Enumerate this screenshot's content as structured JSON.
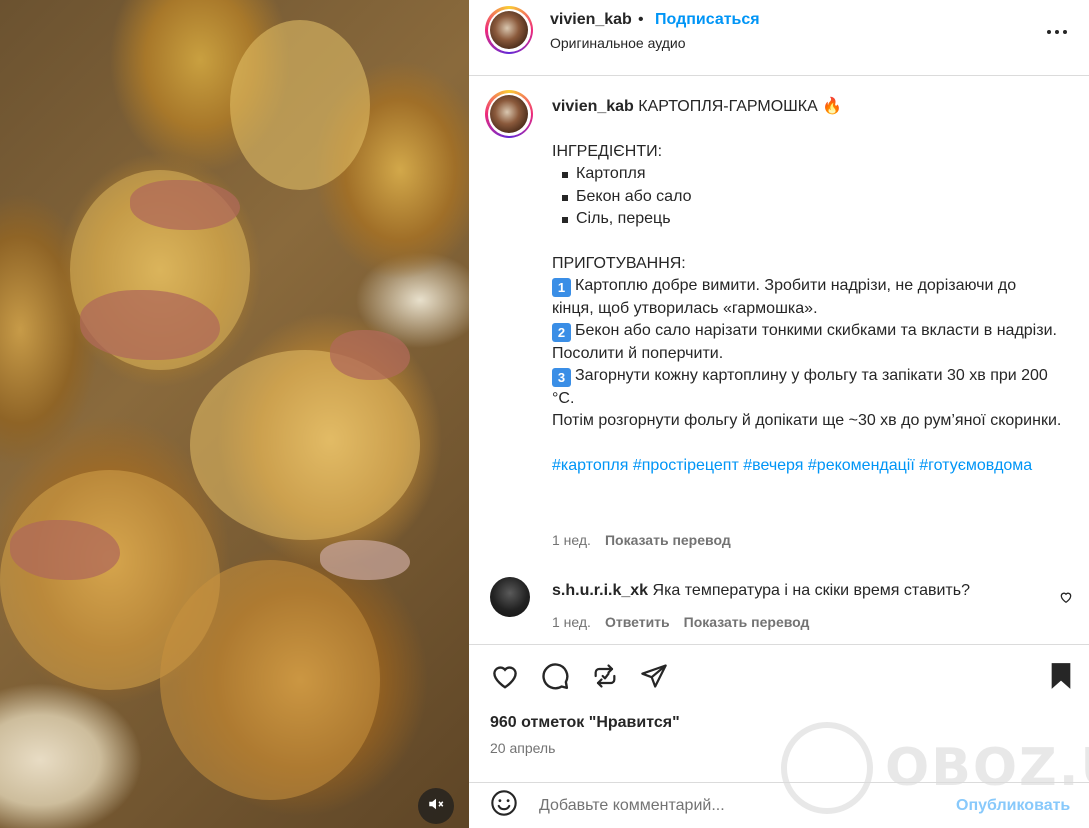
{
  "post": {
    "username": "vivien_kab",
    "dot": "•",
    "follow_label": "Подписаться",
    "audio": "Оригинальное аудио"
  },
  "caption": {
    "username": "vivien_kab",
    "title": "КАРТОПЛЯ-ГАРМОШКА 🔥",
    "ingredients_heading": "ІНГРЕДІЄНТИ:",
    "ingredients": [
      "Картопля",
      "Бекон або сало",
      "Сіль, перець"
    ],
    "steps_heading": "ПРИГОТУВАННЯ:",
    "steps": [
      {
        "num": "1",
        "text": "Картоплю добре вимити. Зробити надрізи, не дорізаючи до кінця, щоб утворилась «гармошка»."
      },
      {
        "num": "2",
        "text": "Бекон або сало нарізати тонкими скибками та вкласти в надрізи. Посолити й поперчити."
      },
      {
        "num": "3",
        "text": "Загорнути кожну картоплину у фольгу та запікати 30 хв при 200 °С."
      }
    ],
    "final": "Потім розгорнути фольгу й допікати ще ~30 хв до рум’яної скоринки.",
    "hashtags": [
      "#картопля",
      "#простірецепт",
      "#вечеря",
      "#рекомендації",
      "#готуємовдома"
    ],
    "age": "1 нед.",
    "translate": "Показать перевод"
  },
  "comment": {
    "username": "s.h.u.r.i.k_xk",
    "text": "Яка температура і на скіки время ставить?",
    "age": "1 нед.",
    "reply": "Ответить",
    "translate": "Показать перевод"
  },
  "likes": "960 отметок \"Нравится\"",
  "date": "20 апрель",
  "add_comment": {
    "placeholder": "Добавьте комментарий...",
    "publish": "Опубликовать"
  },
  "watermark": "OBOZ.UA",
  "icons": [
    "more-icon",
    "heart-icon",
    "comment-icon",
    "share-icon",
    "send-icon",
    "bookmark-icon",
    "emoji-icon",
    "mute-icon"
  ]
}
